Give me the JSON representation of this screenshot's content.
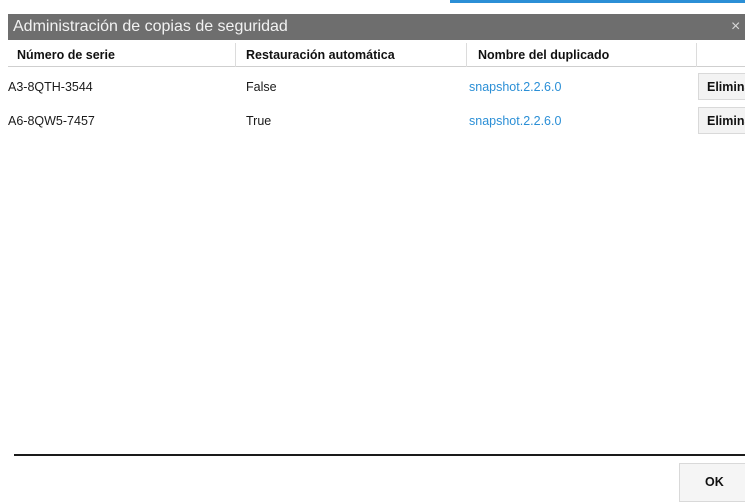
{
  "dialog": {
    "title": "Administración de copias de seguridad",
    "close_glyph": "×"
  },
  "table": {
    "columns": [
      "Número de serie",
      "Restauración automática",
      "Nombre del duplicado"
    ],
    "rows": [
      {
        "serial": "A3-8QTH-3544",
        "auto_restore": "False",
        "duplicate_name": "snapshot.2.2.6.0",
        "action_label": "Eliminar"
      },
      {
        "serial": "A6-8QW5-7457",
        "auto_restore": "True",
        "duplicate_name": "snapshot.2.2.6.0",
        "action_label": "Eliminar"
      }
    ]
  },
  "footer": {
    "ok_label": "OK"
  },
  "colors": {
    "titlebar": "#6e6e6e",
    "link": "#2b8fd6",
    "accent": "#2b8fd6"
  }
}
